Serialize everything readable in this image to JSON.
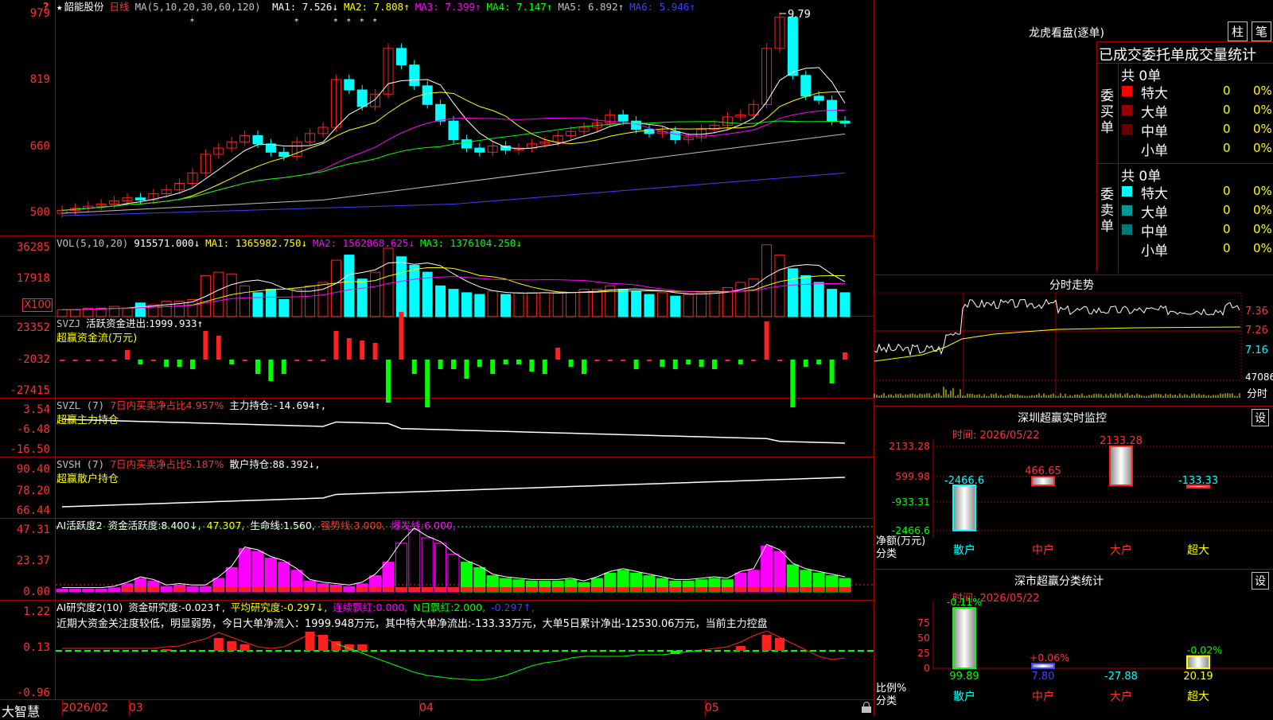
{
  "stock": {
    "name": "韶能股份",
    "period": "日线",
    "ma_label": "MA(5,10,20,30,60,120)",
    "star": "★",
    "mas": [
      {
        "k": "MA1:",
        "v": "7.526",
        "arrow": "↓",
        "c": "#ffffff"
      },
      {
        "k": "MA2:",
        "v": "7.808",
        "arrow": "↑",
        "c": "#ffff00"
      },
      {
        "k": "MA3:",
        "v": "7.399",
        "arrow": "↑",
        "c": "#ff00ff"
      },
      {
        "k": "MA4:",
        "v": "7.147",
        "arrow": "↑",
        "c": "#00ff00"
      },
      {
        "k": "MA5:",
        "v": "6.892",
        "arrow": "↑",
        "c": "#c0c0c0"
      },
      {
        "k": "MA6:",
        "v": "5.946",
        "arrow": "↑",
        "c": "#4040ff"
      }
    ],
    "high_label": "9.79"
  },
  "price_axis": [
    "979",
    "819",
    "660",
    "500"
  ],
  "vol": {
    "label": "VOL(5,10,20)",
    "value": "915571.000↓",
    "ma1": "MA1: 1365982.750↓",
    "ma2": "MA2: 1562868.625↓",
    "ma3": "MA3: 1376104.250↓",
    "axis": [
      "36285",
      "17918"
    ],
    "unit": "X100"
  },
  "svzj": {
    "label": "SVZJ",
    "title": "活跃资金进出:",
    "value": "1999.933↑",
    "sub": "超赢资金流(万元)",
    "axis": [
      "23352",
      "-2032",
      "-27415"
    ]
  },
  "svzl": {
    "label": "SVZL (7)",
    "desc": "7日内买卖净占比4.957%",
    "title": "主力持仓:",
    "value": "-14.694↑,",
    "sub": "超赢主力持仓",
    "axis": [
      "3.54",
      "-6.48",
      "-16.50"
    ]
  },
  "svsh": {
    "label": "SVSH (7)",
    "desc": "7日内买卖净占比5.187%",
    "title": "散户持仓:",
    "value": "88.392↓,",
    "sub": "超赢散户持仓",
    "axis": [
      "90.40",
      "78.20",
      "66.44"
    ]
  },
  "ai1": {
    "label": "AI活跃度2",
    "t1": "资金活跃度:",
    "v1": "8.400↓,",
    "v2": "47.307,",
    "t3": "生命线:",
    "v3": "1.560,",
    "t4": "强势线:",
    "v4": "3.000,",
    "t5": "爆发线:",
    "v5": "6.000,",
    "axis": [
      "47.31",
      "23.37",
      "0.00"
    ]
  },
  "ai2": {
    "label": "AI研究度2(10)",
    "t1": "资金研究度:",
    "v1": "-0.023↑,",
    "t2": "平均研究度:",
    "v2": "-0.297↓,",
    "t3": "连续飘红:",
    "v3": "0.000,",
    "t4": "N日飘红:",
    "v4": "2.000,",
    "v5": "-0.297↑,",
    "note": "近期大资金关注度较低，明显弱势，今日大单净流入：1999.948万元，其中特大单净流出:-133.33万元，大单5日累计净出-12530.06万元，当前主力控盘",
    "axis": [
      "1.22",
      "0.13",
      "-0.96"
    ]
  },
  "xaxis": {
    "brand": "大智慧",
    "labels": [
      "2026/02",
      "03",
      "04",
      "05"
    ]
  },
  "lhb": {
    "title": "龙虎看盘(逐单)",
    "btn1": "柱",
    "btn2": "笔",
    "header": "已成交委托单成交量统计",
    "buy": {
      "side": "委买单",
      "total": "共 0单",
      "rows": [
        {
          "n": "特大",
          "q": "0",
          "p": "0%",
          "c": "#ff0000"
        },
        {
          "n": "大单",
          "q": "0",
          "p": "0%",
          "c": "#990000"
        },
        {
          "n": "中单",
          "q": "0",
          "p": "0%",
          "c": "#660000"
        },
        {
          "n": "小单",
          "q": "0",
          "p": "0%",
          "c": ""
        }
      ]
    },
    "sell": {
      "side": "委卖单",
      "total": "共 0单",
      "rows": [
        {
          "n": "特大",
          "q": "0",
          "p": "0%",
          "c": "#00ffff"
        },
        {
          "n": "大单",
          "q": "0",
          "p": "0%",
          "c": "#009999"
        },
        {
          "n": "中单",
          "q": "0",
          "p": "0%",
          "c": "#007777"
        },
        {
          "n": "小单",
          "q": "0",
          "p": "0%",
          "c": ""
        }
      ]
    }
  },
  "intraday": {
    "title": "分时走势",
    "axis": [
      "7.36",
      "7.26",
      "7.16",
      "47086"
    ],
    "unit": "分时"
  },
  "mon": {
    "title": "深圳超赢实时监控",
    "btn": "设",
    "time": "时间: 2026/05/22",
    "axis": [
      "2133.28",
      "599.98",
      "-933.31",
      "-2466.6"
    ],
    "bars": [
      {
        "label": "-2466.6",
        "value": -2466.6
      },
      {
        "label": "466.65",
        "value": 466.65
      },
      {
        "label": "2133.28",
        "value": 2133.28
      },
      {
        "label": "-133.33",
        "value": -133.33
      }
    ],
    "cats": [
      "散户",
      "中户",
      "大户",
      "超大"
    ],
    "ylabel": "净额(万元)",
    "xlabel": "分类"
  },
  "cls": {
    "title": "深市超赢分类统计",
    "btn": "设",
    "time": "时间: 2026/05/22",
    "axis": [
      "75",
      "50",
      "25",
      "0"
    ],
    "bars": [
      {
        "top": "-0.11%",
        "value": 99.89,
        "bottom": "99.89",
        "c": "#00ff00"
      },
      {
        "top": "+0.06%",
        "value": 7.8,
        "bottom": "7.80",
        "c": "#4040ff"
      },
      {
        "top": "",
        "value": -27.88,
        "bottom": "-27.88",
        "c": "#00ffff"
      },
      {
        "top": "-0.02%",
        "value": 20.19,
        "bottom": "20.19",
        "c": "#ffff00"
      }
    ],
    "cats": [
      "散户",
      "中户",
      "大户",
      "超大"
    ],
    "ylabel": "比例%",
    "xlabel": "分类"
  }
}
